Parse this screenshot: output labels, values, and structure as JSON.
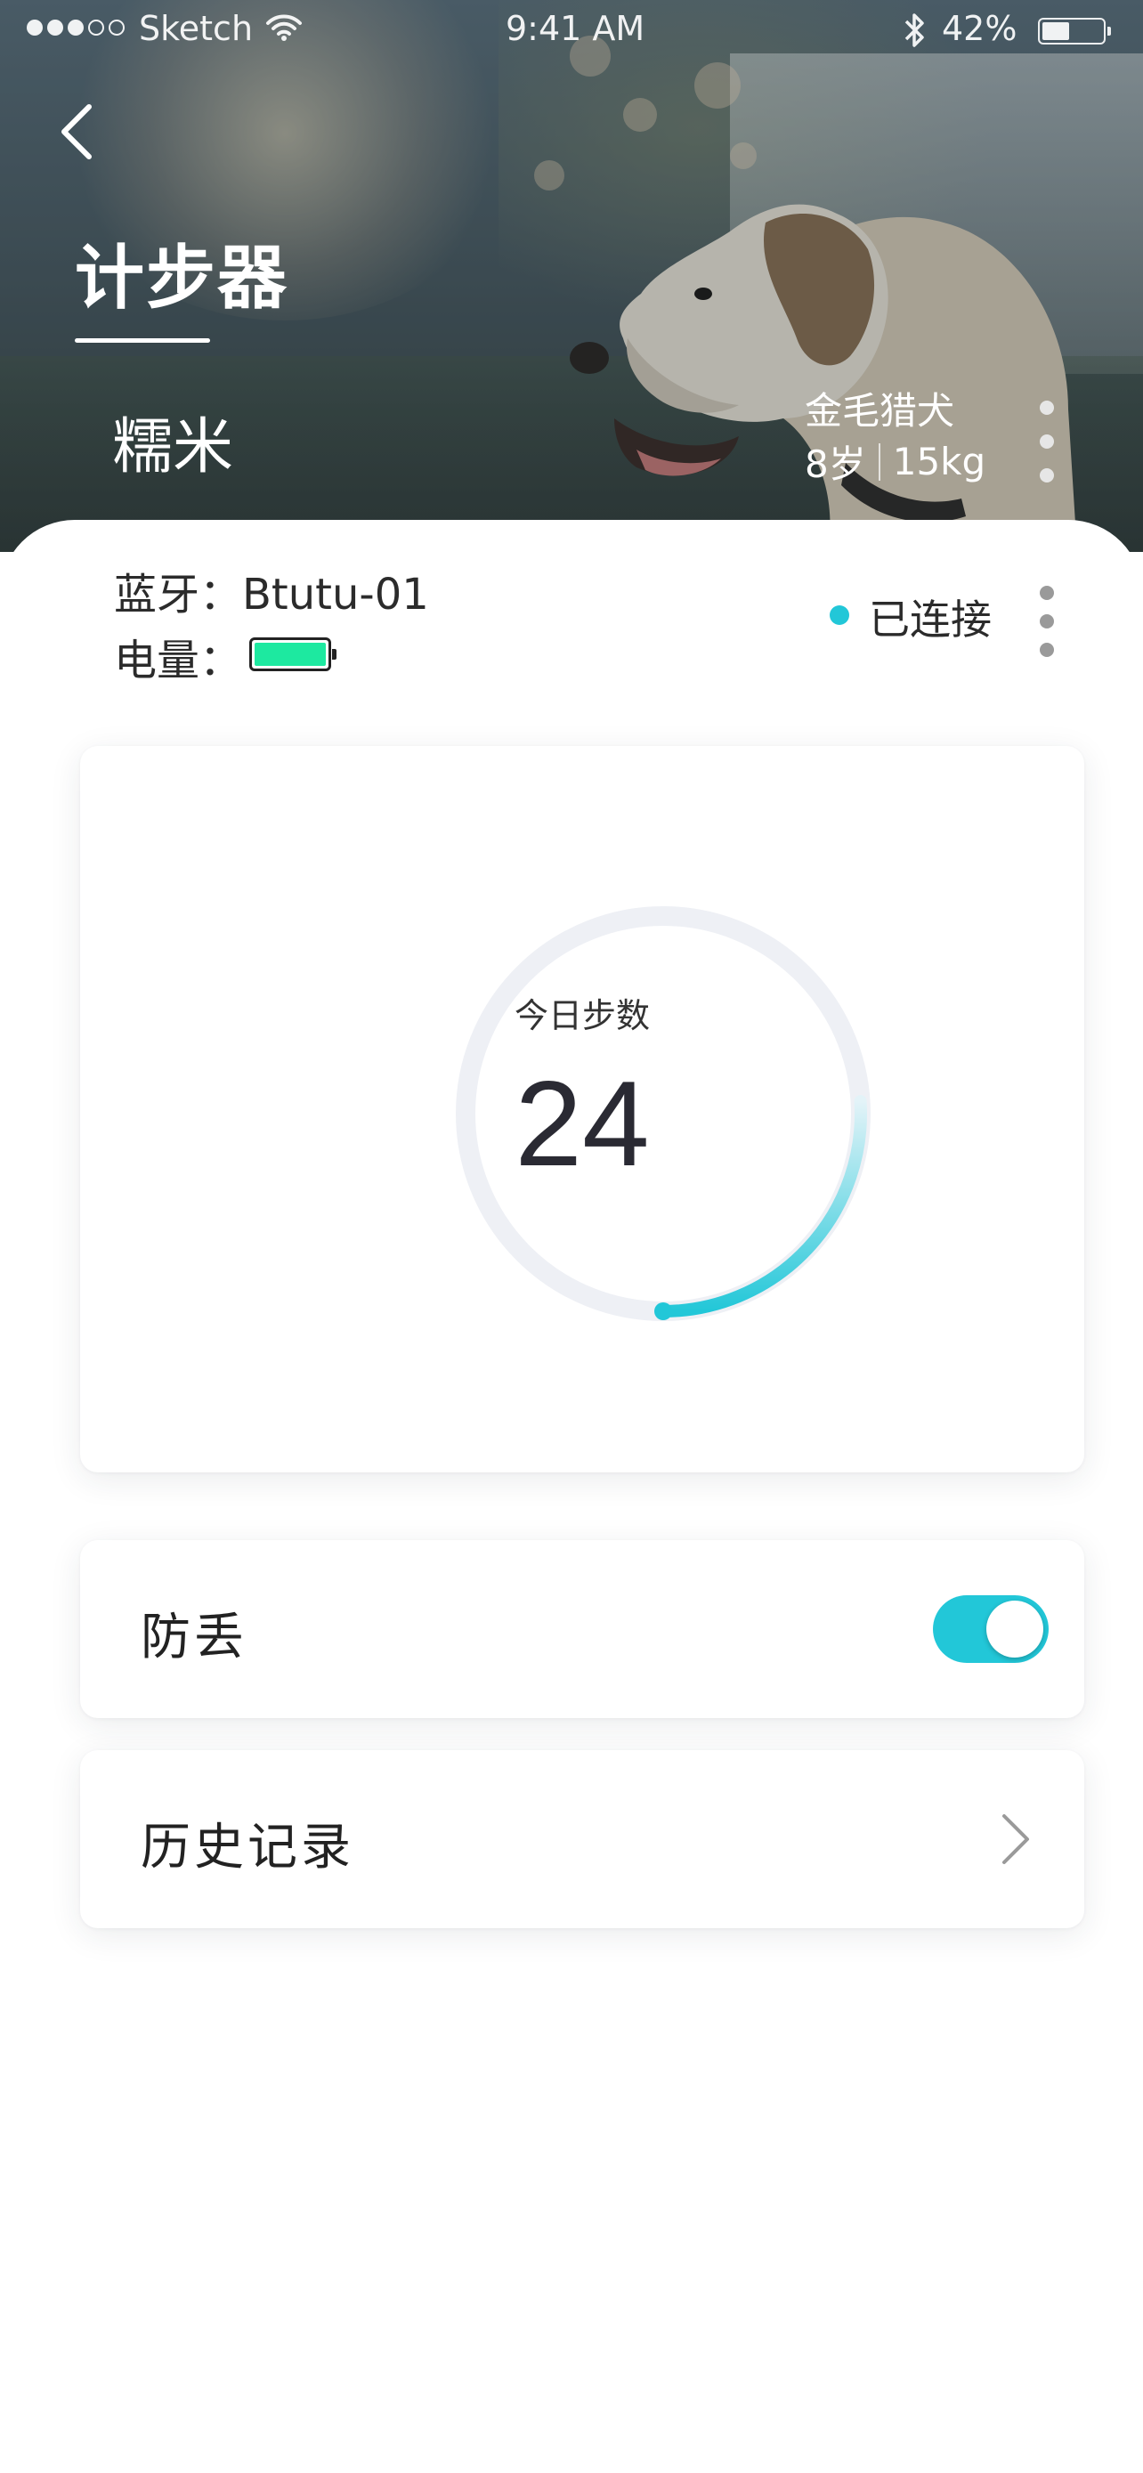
{
  "status_bar": {
    "carrier": "Sketch",
    "time": "9:41 AM",
    "battery_percent": "42%",
    "battery_level": 0.42,
    "signal_bars_filled": 3,
    "signal_bars_total": 5
  },
  "header": {
    "back_icon": "chevron-left-icon",
    "title": "计步器",
    "pet_name": "糯米",
    "breed": "金毛猎犬",
    "age": "8岁",
    "weight": "15kg",
    "more_icon": "more-vertical-icon"
  },
  "device": {
    "bluetooth_label": "蓝牙：Btutu-01",
    "power_label": "电量：",
    "battery_level": 1.0,
    "connection_status": "已连接",
    "more_icon": "more-vertical-icon"
  },
  "steps": {
    "label": "今日步数",
    "value": "24",
    "progress": 0.26
  },
  "settings": {
    "anti_lost_label": "防丢",
    "anti_lost_enabled": true,
    "history_label": "历史记录",
    "history_icon": "chevron-right-icon"
  },
  "colors": {
    "accent": "#22c7d8",
    "battery_fill": "#1de9a0",
    "ring_track": "#eef0f5",
    "text": "#222222",
    "more_dots_light": "#e6e6e6",
    "more_dots_gray": "#9a9a9a"
  }
}
